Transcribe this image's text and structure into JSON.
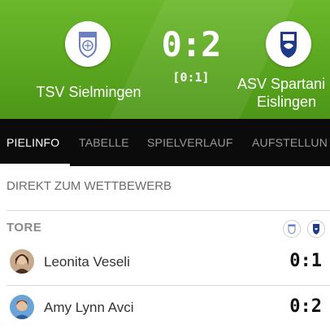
{
  "match": {
    "home_team": "TSV Sielmingen",
    "away_team_line1": "ASV Spartani",
    "away_team_line2": "Eislingen",
    "score": "0:2",
    "halftime": "[0:1]"
  },
  "tabs": [
    {
      "label": "PIELINFO",
      "active": true
    },
    {
      "label": "TABELLE",
      "active": false
    },
    {
      "label": "SPIELVERLAUF",
      "active": false
    },
    {
      "label": "AUFSTELLUN",
      "active": false
    }
  ],
  "direct_link": "DIREKT ZUM WETTBEWERB",
  "goals_section": {
    "title": "TORE",
    "goals": [
      {
        "player": "Leonita Veseli",
        "score": "0:1"
      },
      {
        "player": "Amy Lynn Avci",
        "score": "0:2"
      }
    ]
  },
  "colors": {
    "header_green": "#5aa61f",
    "tab_bar": "#0b0b0b",
    "home_crest": "#6b7fc4",
    "away_crest": "#1f3a8a"
  }
}
